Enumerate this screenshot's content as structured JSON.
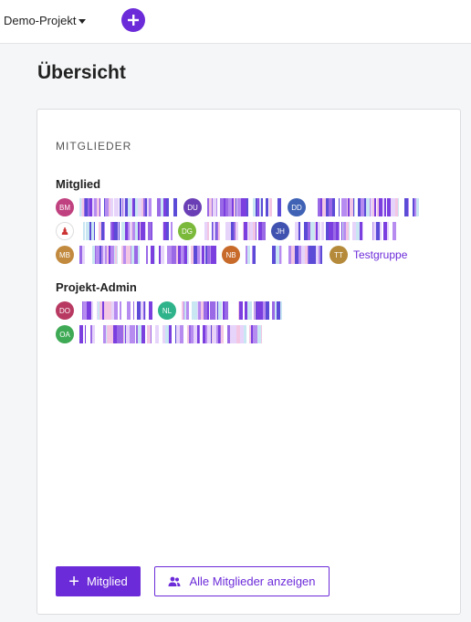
{
  "topbar": {
    "project_name": "Demo-Projekt",
    "project_caret_icon": "caret-down-icon",
    "add_icon": "plus-circle-icon"
  },
  "page": {
    "title": "Übersicht"
  },
  "members_card": {
    "section_label": "MITGLIEDER",
    "roles": [
      {
        "title": "Mitglied",
        "members": [
          {
            "initials": "BM",
            "color": "#c0417f"
          },
          {
            "initials": "DU",
            "color": "#6a3fb5"
          },
          {
            "initials": "DD",
            "color": "#3f62b5"
          },
          {
            "initials": "",
            "color": "#ffffff",
            "icon": "user-photo-icon"
          },
          {
            "initials": "DG",
            "color": "#7bb93a"
          },
          {
            "initials": "JH",
            "color": "#3f52b0"
          },
          {
            "initials": "MB",
            "color": "#c28a3e"
          },
          {
            "initials": "NB",
            "color": "#c76a2a"
          },
          {
            "initials": "TT",
            "color": "#b58a3a"
          }
        ],
        "group_link": "Testgruppe"
      },
      {
        "title": "Projekt-Admin",
        "members": [
          {
            "initials": "DO",
            "color": "#b83a62"
          },
          {
            "initials": "NL",
            "color": "#2fb38a"
          },
          {
            "initials": "OA",
            "color": "#3faa55"
          }
        ]
      }
    ],
    "add_member_button": "Mitglied",
    "show_all_button": "Alle Mitglieder anzeigen",
    "show_all_icon": "users-icon"
  },
  "colors": {
    "accent": "#6c2bd9",
    "background": "#f5f6f7",
    "card": "#ffffff"
  }
}
